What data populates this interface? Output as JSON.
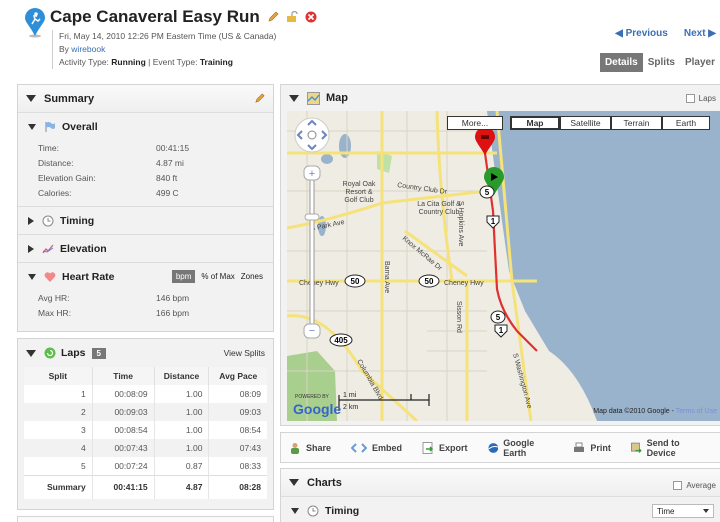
{
  "header": {
    "title": "Cape Canaveral Easy Run",
    "datetime": "Fri, May 14, 2010 12:26 PM Eastern Time (US & Canada)",
    "by_label": "By",
    "author": "wirebook",
    "activity_type_label": "Activity Type:",
    "activity_type": "Running",
    "event_type_label": "| Event Type:",
    "event_type": "Training",
    "icons": [
      "running-pin-icon",
      "edit-pencil-icon",
      "lock-icon",
      "delete-icon"
    ]
  },
  "nav": {
    "previous": "Previous",
    "next": "Next"
  },
  "view_tabs": [
    {
      "label": "Details",
      "active": true
    },
    {
      "label": "Splits",
      "active": false
    },
    {
      "label": "Player",
      "active": false
    }
  ],
  "summary": {
    "title": "Summary",
    "overall": {
      "title": "Overall",
      "rows": [
        {
          "label": "Time:",
          "value": "00:41:15"
        },
        {
          "label": "Distance:",
          "value": "4.87 mi"
        },
        {
          "label": "Elevation Gain:",
          "value": "840 ft"
        },
        {
          "label": "Calories:",
          "value": "499 C"
        }
      ]
    },
    "timing": {
      "title": "Timing"
    },
    "elevation": {
      "title": "Elevation"
    },
    "heart_rate": {
      "title": "Heart Rate",
      "units": [
        "bpm",
        "% of Max",
        "Zones"
      ],
      "active_unit": "bpm",
      "rows": [
        {
          "label": "Avg HR:",
          "value": "146 bpm"
        },
        {
          "label": "Max HR:",
          "value": "166 bpm"
        }
      ]
    }
  },
  "laps": {
    "title": "Laps",
    "count": "5",
    "view_splits": "View Splits",
    "columns": [
      "Split",
      "Time",
      "Distance",
      "Avg Pace"
    ],
    "rows": [
      [
        "1",
        "00:08:09",
        "1.00",
        "08:09"
      ],
      [
        "2",
        "00:09:03",
        "1.00",
        "09:03"
      ],
      [
        "3",
        "00:08:54",
        "1.00",
        "08:54"
      ],
      [
        "4",
        "00:07:43",
        "1.00",
        "07:43"
      ],
      [
        "5",
        "00:07:24",
        "0.87",
        "08:33"
      ]
    ],
    "summary_row": [
      "Summary",
      "00:41:15",
      "4.87",
      "08:28"
    ]
  },
  "map": {
    "title": "Map",
    "laps_checkbox": "Laps",
    "more_button": "More...",
    "type_buttons": [
      "Map",
      "Satellite",
      "Terrain",
      "Earth"
    ],
    "selected_type": "Map",
    "labels": {
      "royal_oak": [
        "Royal Oak",
        "Resort &",
        "Golf Club"
      ],
      "la_cita": [
        "La Cita Golf &",
        "Country Club"
      ],
      "country_club_dr": "Country Club Dr",
      "s_park_ave": "S Park Ave",
      "knox_mcrae": "Knox McRae Dr",
      "barna_ave": "Barna Ave",
      "s_hopkins": "S Hopkins Ave",
      "cheney_hwy": "Cheney Hwy",
      "sisson_rd": "Sisson Rd",
      "columbia_blvd": "Columbia Blvd",
      "s_washington": "S Washington Ave",
      "route_50": "50",
      "route_405": "405",
      "route_5": "5",
      "route_1": "1"
    },
    "scale": {
      "mi": "1 mi",
      "km": "2 km"
    },
    "powered_by": "POWERED BY",
    "google": "Google",
    "credit": "Map data ©2010 Google -",
    "terms": "Terms of Use",
    "route_color": "#e03030",
    "water_color": "#99b3cc"
  },
  "actions": [
    {
      "label": "Share",
      "icon": "share-icon"
    },
    {
      "label": "Embed",
      "icon": "embed-icon"
    },
    {
      "label": "Export",
      "icon": "export-icon"
    },
    {
      "label": "Google Earth",
      "icon": "google-earth-icon"
    },
    {
      "label": "Print",
      "icon": "print-icon"
    },
    {
      "label": "Send to Device",
      "icon": "send-to-device-icon"
    }
  ],
  "charts": {
    "title": "Charts",
    "average_checkbox": "Average",
    "timing": {
      "title": "Timing",
      "select_value": "Time"
    }
  }
}
